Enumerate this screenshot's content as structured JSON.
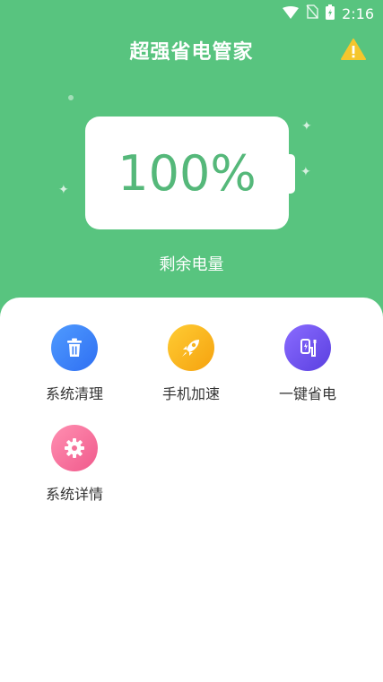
{
  "status_bar": {
    "time": "2:16",
    "icons": [
      "wifi-icon",
      "no-sim-icon",
      "battery-charging-icon"
    ]
  },
  "header": {
    "title": "超强省电管家",
    "warning_icon": "warning-icon"
  },
  "battery": {
    "percent_label": "100%",
    "level": 1.0,
    "remaining_label": "剩余电量"
  },
  "colors": {
    "brand_green": "#58c47f",
    "percent_text": "#55b87a"
  },
  "features": [
    {
      "label": "系统清理",
      "icon": "trash-icon",
      "color_from": "#4f9bff",
      "color_to": "#2f6ff2"
    },
    {
      "label": "手机加速",
      "icon": "rocket-icon",
      "color_from": "#ffcc33",
      "color_to": "#f5a20f"
    },
    {
      "label": "一键省电",
      "icon": "plug-icon",
      "color_from": "#8a6cff",
      "color_to": "#5a3fe0"
    },
    {
      "label": "系统详情",
      "icon": "gear-icon",
      "color_from": "#ff8fb1",
      "color_to": "#f05a8c"
    }
  ]
}
